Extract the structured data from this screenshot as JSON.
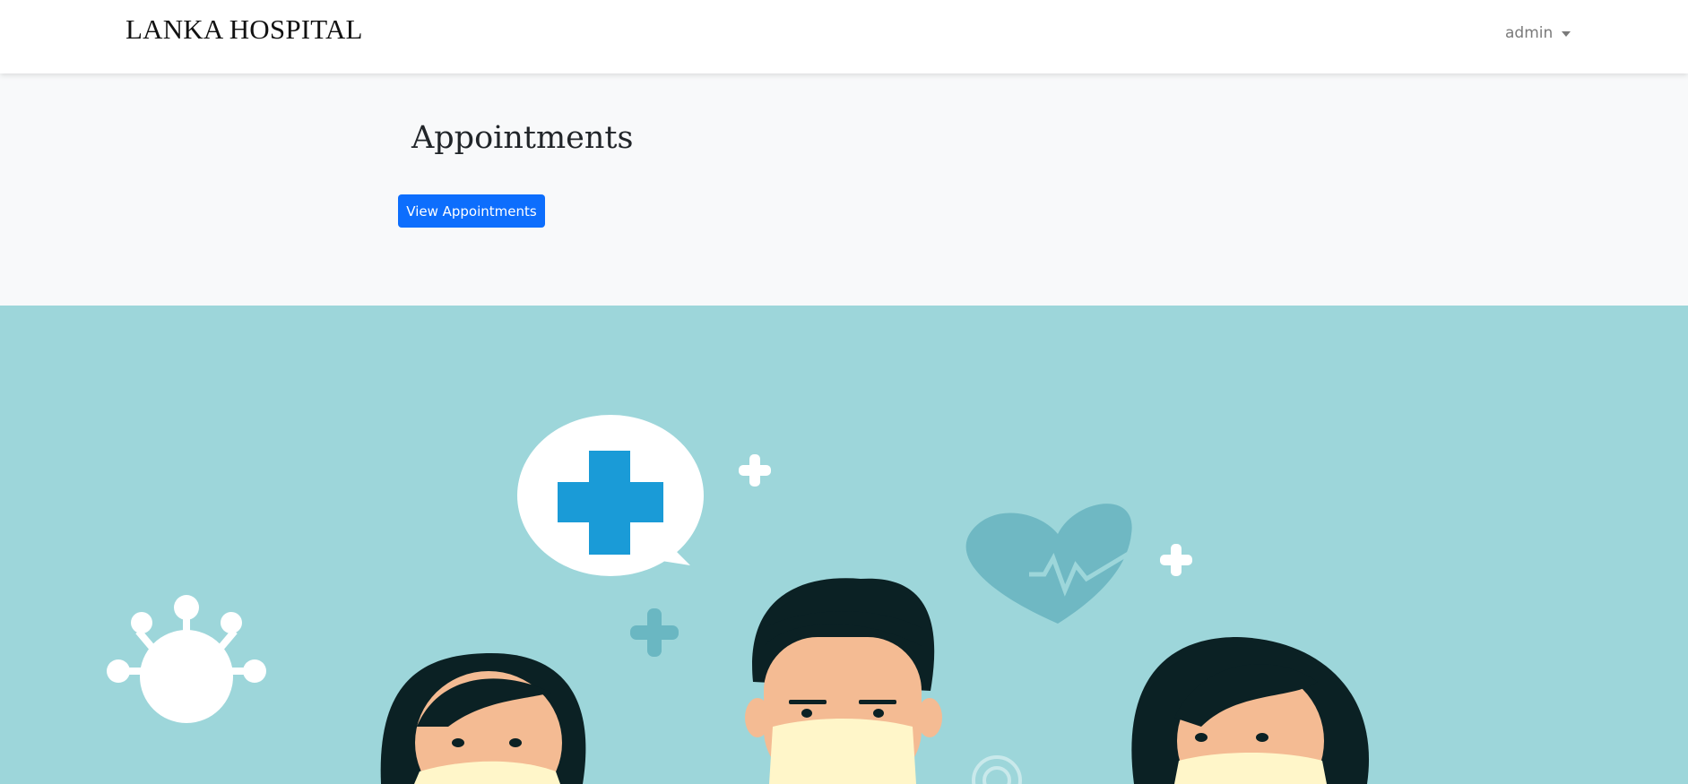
{
  "navbar": {
    "brand": "LANKA HOSPITAL",
    "user_menu": {
      "label": "admin",
      "icon": "caret-down-icon"
    }
  },
  "main": {
    "title": "Appointments",
    "view_button_label": "View Appointments"
  },
  "hero": {
    "description_icons": [
      "speech-bubble-cross-icon",
      "plus-icon",
      "heart-pulse-icon",
      "virus-icon",
      "people-with-masks"
    ]
  },
  "colors": {
    "primary": "#0d6efd",
    "hero_background": "#9dd6da",
    "page_background": "#f8f9fa",
    "cross_blue": "#1a9bd7"
  }
}
